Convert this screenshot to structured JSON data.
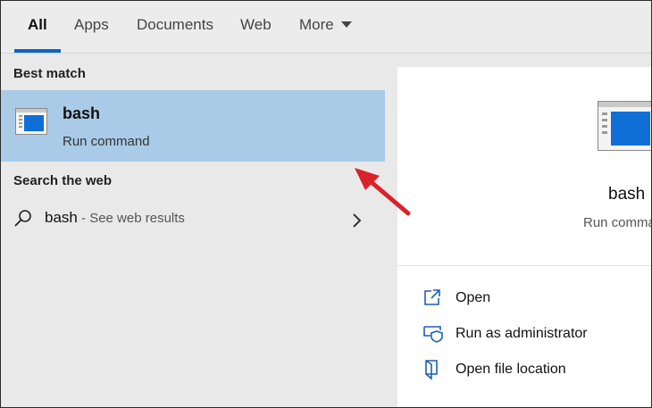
{
  "tabs": [
    {
      "label": "All"
    },
    {
      "label": "Apps"
    },
    {
      "label": "Documents"
    },
    {
      "label": "Web"
    },
    {
      "label": "More"
    }
  ],
  "best_match": {
    "section_title": "Best match",
    "name": "bash",
    "subtitle": "Run command",
    "icon": "window-app-icon"
  },
  "web": {
    "section_title": "Search the web",
    "query": "bash",
    "hint": " - See web results",
    "icon": "search-icon"
  },
  "preview": {
    "name": "bash",
    "subtitle": "Run command",
    "icon": "window-app-icon"
  },
  "actions": [
    {
      "label": "Open",
      "icon": "open-icon"
    },
    {
      "label": "Run as administrator",
      "icon": "shield-icon"
    },
    {
      "label": "Open file location",
      "icon": "folder-icon"
    }
  ],
  "colors": {
    "selection": "#a9cbe7",
    "accent": "#0a64c8",
    "annotation_arrow": "#d9222a"
  }
}
